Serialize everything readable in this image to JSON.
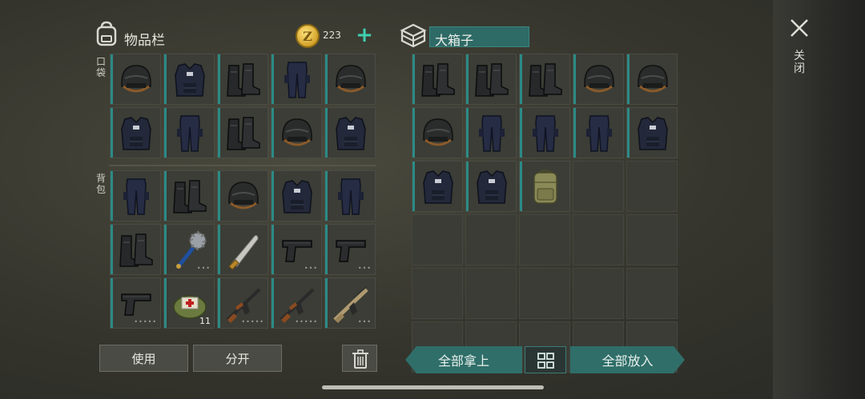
{
  "inventory": {
    "title": "物品栏",
    "coins": "223",
    "pocket_label": "口袋",
    "backpack_label": "背包",
    "pocket": [
      {
        "item": "helmet"
      },
      {
        "item": "vest"
      },
      {
        "item": "boots"
      },
      {
        "item": "pants"
      },
      {
        "item": "helmet"
      },
      {
        "item": "vest"
      },
      {
        "item": "pants"
      },
      {
        "item": "boots"
      },
      {
        "item": "helmet"
      },
      {
        "item": "vest"
      }
    ],
    "backpack": [
      {
        "item": "pants"
      },
      {
        "item": "boots"
      },
      {
        "item": "helmet"
      },
      {
        "item": "vest"
      },
      {
        "item": "pants"
      },
      {
        "item": "boots"
      },
      {
        "item": "mace",
        "dots": "•••"
      },
      {
        "item": "machete"
      },
      {
        "item": "pistol",
        "dots": "•••"
      },
      {
        "item": "pistol",
        "dots": "•••"
      },
      {
        "item": "pistol",
        "dots": "•••••"
      },
      {
        "item": "medkit",
        "count": "11"
      },
      {
        "item": "rifle",
        "dots": "•••••"
      },
      {
        "item": "rifle",
        "dots": "•••••"
      },
      {
        "item": "rifle-tan",
        "dots": "•••"
      }
    ]
  },
  "container": {
    "title": "大箱子",
    "items": [
      {
        "item": "boots"
      },
      {
        "item": "boots"
      },
      {
        "item": "boots"
      },
      {
        "item": "helmet"
      },
      {
        "item": "helmet"
      },
      {
        "item": "helmet"
      },
      {
        "item": "pants"
      },
      {
        "item": "pants"
      },
      {
        "item": "pants"
      },
      {
        "item": "vest"
      },
      {
        "item": "vest"
      },
      {
        "item": "vest"
      },
      {
        "item": "backpack"
      },
      {
        "item": ""
      },
      {
        "item": ""
      },
      {
        "item": ""
      },
      {
        "item": ""
      },
      {
        "item": ""
      },
      {
        "item": ""
      },
      {
        "item": ""
      },
      {
        "item": ""
      },
      {
        "item": ""
      },
      {
        "item": ""
      },
      {
        "item": ""
      },
      {
        "item": ""
      },
      {
        "item": ""
      },
      {
        "item": ""
      },
      {
        "item": ""
      },
      {
        "item": ""
      },
      {
        "item": ""
      }
    ]
  },
  "buttons": {
    "use": "使用",
    "split": "分开",
    "take_all": "全部拿上",
    "put_all": "全部放入",
    "close": "关闭"
  },
  "colors": {
    "accent": "#2f6e69",
    "slot_bar": "#2c8a86",
    "coin": "#d4a22a",
    "plus": "#3fd0b0"
  }
}
